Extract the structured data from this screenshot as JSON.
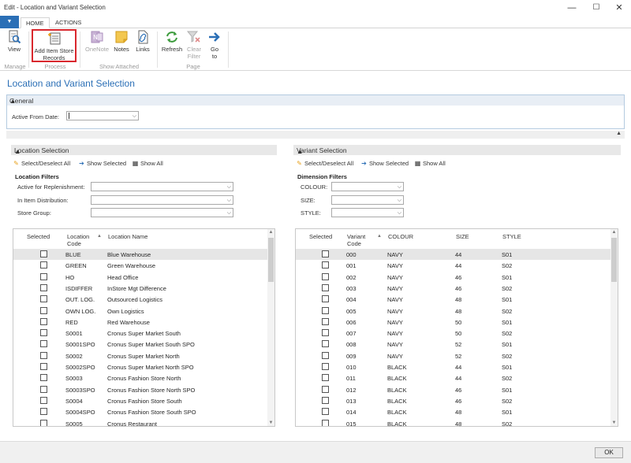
{
  "window": {
    "title": "Edit - Location and Variant Selection",
    "minimize": "—",
    "maximize": "☐",
    "close": "✕"
  },
  "ribbon": {
    "tabs": [
      {
        "label": "HOME"
      },
      {
        "label": "ACTIONS"
      }
    ],
    "buttons": [
      {
        "label": "View",
        "icon": "view-icon"
      },
      {
        "label": "Add Item Store Records",
        "line1": "Add Item Store",
        "line2": "Records",
        "icon": "add-records-icon"
      },
      {
        "label": "OneNote",
        "icon": "onenote-icon"
      },
      {
        "label": "Notes",
        "icon": "notes-icon"
      },
      {
        "label": "Links",
        "icon": "links-icon"
      },
      {
        "label": "Refresh",
        "icon": "refresh-icon"
      },
      {
        "label": "Clear Filter",
        "line1": "Clear",
        "line2": "Filter",
        "icon": "clear-filter-icon"
      },
      {
        "label": "Go to",
        "line1": "Go",
        "line2": "to",
        "icon": "go-to-icon"
      }
    ],
    "groups": [
      "Manage",
      "Process",
      "Show Attached",
      "Page"
    ]
  },
  "page": {
    "title": "Location and Variant Selection"
  },
  "general": {
    "header": "General",
    "active_from_label": "Active From Date:",
    "active_from_value": ""
  },
  "location": {
    "header": "Location Selection",
    "actions": [
      "Select/Deselect All",
      "Show Selected",
      "Show All"
    ],
    "filters_title": "Location Filters",
    "filters": [
      "Active for Replenishment:",
      "In Item Distribution:",
      "Store Group:"
    ],
    "columns": {
      "selected": "Selected",
      "code1": "Location",
      "code2": "Code",
      "name": "Location Name"
    },
    "rows": [
      {
        "code": "BLUE",
        "name": "Blue Warehouse"
      },
      {
        "code": "GREEN",
        "name": "Green Warehouse"
      },
      {
        "code": "HO",
        "name": "Head Office"
      },
      {
        "code": "ISDIFFER",
        "name": "InStore Mgt Difference"
      },
      {
        "code": "OUT. LOG.",
        "name": "Outsourced Logistics"
      },
      {
        "code": "OWN LOG.",
        "name": "Own Logistics"
      },
      {
        "code": "RED",
        "name": "Red Warehouse"
      },
      {
        "code": "S0001",
        "name": "Cronus Super Market South"
      },
      {
        "code": "S0001SPO",
        "name": "Cronus Super Market South SPO"
      },
      {
        "code": "S0002",
        "name": "Cronus Super Market North"
      },
      {
        "code": "S0002SPO",
        "name": "Cronus Super Market North SPO"
      },
      {
        "code": "S0003",
        "name": "Cronus Fashion Store North"
      },
      {
        "code": "S0003SPO",
        "name": "Cronus Fashion Store North SPO"
      },
      {
        "code": "S0004",
        "name": "Cronus Fashion Store South"
      },
      {
        "code": "S0004SPO",
        "name": "Cronus Fashion Store South SPO"
      },
      {
        "code": "S0005",
        "name": "Cronus Restaurant"
      }
    ]
  },
  "variant": {
    "header": "Variant Selection",
    "actions": [
      "Select/Deselect All",
      "Show Selected",
      "Show All"
    ],
    "filters_title": "Dimension Filters",
    "filters": [
      "COLOUR:",
      "SIZE:",
      "STYLE:"
    ],
    "columns": {
      "selected": "Selected",
      "code1": "Variant",
      "code2": "Code",
      "colour": "COLOUR",
      "size": "SIZE",
      "style": "STYLE"
    },
    "rows": [
      {
        "code": "000",
        "colour": "NAVY",
        "size": "44",
        "style": "S01"
      },
      {
        "code": "001",
        "colour": "NAVY",
        "size": "44",
        "style": "S02"
      },
      {
        "code": "002",
        "colour": "NAVY",
        "size": "46",
        "style": "S01"
      },
      {
        "code": "003",
        "colour": "NAVY",
        "size": "46",
        "style": "S02"
      },
      {
        "code": "004",
        "colour": "NAVY",
        "size": "48",
        "style": "S01"
      },
      {
        "code": "005",
        "colour": "NAVY",
        "size": "48",
        "style": "S02"
      },
      {
        "code": "006",
        "colour": "NAVY",
        "size": "50",
        "style": "S01"
      },
      {
        "code": "007",
        "colour": "NAVY",
        "size": "50",
        "style": "S02"
      },
      {
        "code": "008",
        "colour": "NAVY",
        "size": "52",
        "style": "S01"
      },
      {
        "code": "009",
        "colour": "NAVY",
        "size": "52",
        "style": "S02"
      },
      {
        "code": "010",
        "colour": "BLACK",
        "size": "44",
        "style": "S01"
      },
      {
        "code": "011",
        "colour": "BLACK",
        "size": "44",
        "style": "S02"
      },
      {
        "code": "012",
        "colour": "BLACK",
        "size": "46",
        "style": "S01"
      },
      {
        "code": "013",
        "colour": "BLACK",
        "size": "46",
        "style": "S02"
      },
      {
        "code": "014",
        "colour": "BLACK",
        "size": "48",
        "style": "S01"
      },
      {
        "code": "015",
        "colour": "BLACK",
        "size": "48",
        "style": "S02"
      }
    ]
  },
  "footer": {
    "ok": "OK"
  },
  "colors": {
    "accent": "#2b6fb6",
    "highlight_border": "#d9282e",
    "selected_row": "#e6e6e6"
  }
}
